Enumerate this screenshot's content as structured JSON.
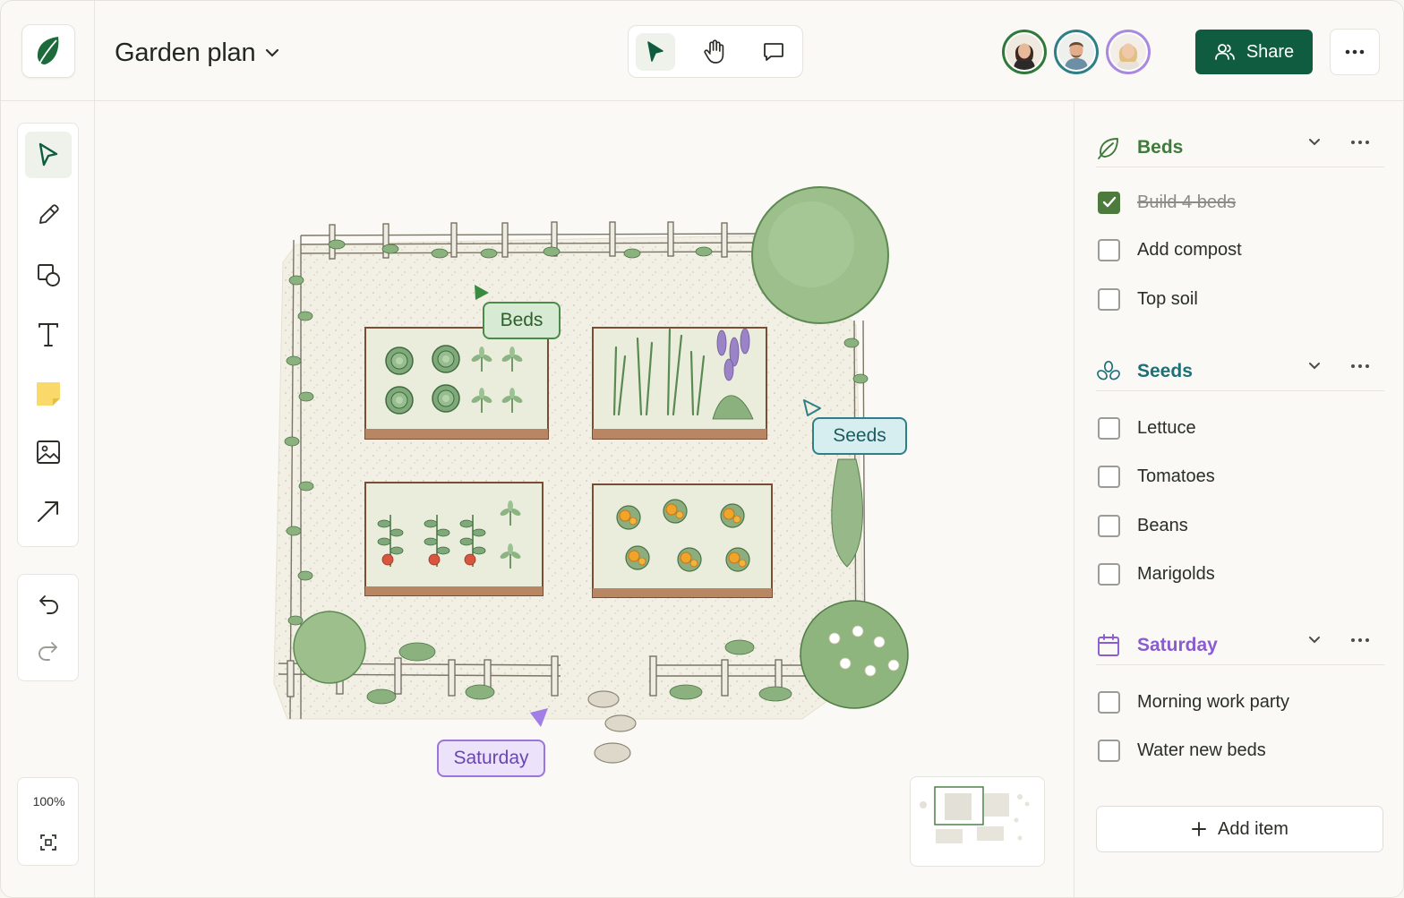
{
  "header": {
    "title": "Garden plan",
    "share_label": "Share",
    "collaborators": [
      "collaborator-1",
      "collaborator-2",
      "collaborator-3"
    ]
  },
  "canvas": {
    "tags": {
      "beds": "Beds",
      "seeds": "Seeds",
      "saturday": "Saturday"
    },
    "zoom": "100%"
  },
  "panel": {
    "sections": [
      {
        "title": "Beds",
        "color": "#3f7a3a",
        "icon": "leaf-icon",
        "items": [
          {
            "label": "Build 4 beds",
            "checked": true
          },
          {
            "label": "Add compost",
            "checked": false
          },
          {
            "label": "Top soil",
            "checked": false
          }
        ]
      },
      {
        "title": "Seeds",
        "color": "#1f6f78",
        "icon": "seeds-icon",
        "items": [
          {
            "label": "Lettuce",
            "checked": false
          },
          {
            "label": "Tomatoes",
            "checked": false
          },
          {
            "label": "Beans",
            "checked": false
          },
          {
            "label": "Marigolds",
            "checked": false
          }
        ]
      },
      {
        "title": "Saturday",
        "color": "#8a5ccf",
        "icon": "calendar-icon",
        "items": [
          {
            "label": "Morning work party",
            "checked": false
          },
          {
            "label": "Water new beds",
            "checked": false
          }
        ]
      }
    ],
    "add_item_label": "Add item"
  },
  "colors": {
    "brand": "#0f5c40",
    "beds_tag": "#4a8a4a",
    "seeds_tag": "#2f7f86",
    "saturday_tag": "#9b74dd"
  }
}
